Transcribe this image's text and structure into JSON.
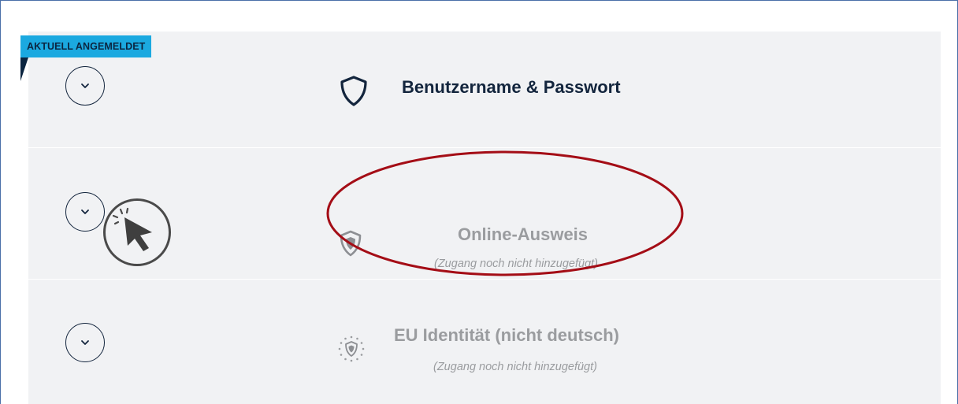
{
  "badge": {
    "label": "AKTUELL ANGEMELDET"
  },
  "options": [
    {
      "title": "Benutzername & Passwort",
      "subtitle": ""
    },
    {
      "title": "Online-Ausweis",
      "subtitle": "(Zugang noch nicht hinzugefügt)"
    },
    {
      "title": "EU Identität (nicht deutsch)",
      "subtitle": "(Zugang noch nicht hinzugefügt)"
    }
  ],
  "icons": {
    "expand": "chevron-down-icon",
    "option_1": "shield-outline-icon",
    "option_2": "shield-filled-icon",
    "option_3": "eu-shield-stars-icon",
    "pointer": "cursor-click-icon"
  },
  "colors": {
    "badge_bg": "#1ba9e0",
    "dark_text": "#13253d",
    "muted_text": "#9a9c9f",
    "panel_bg": "#f1f2f4",
    "highlight_ellipse": "#a40d16"
  }
}
